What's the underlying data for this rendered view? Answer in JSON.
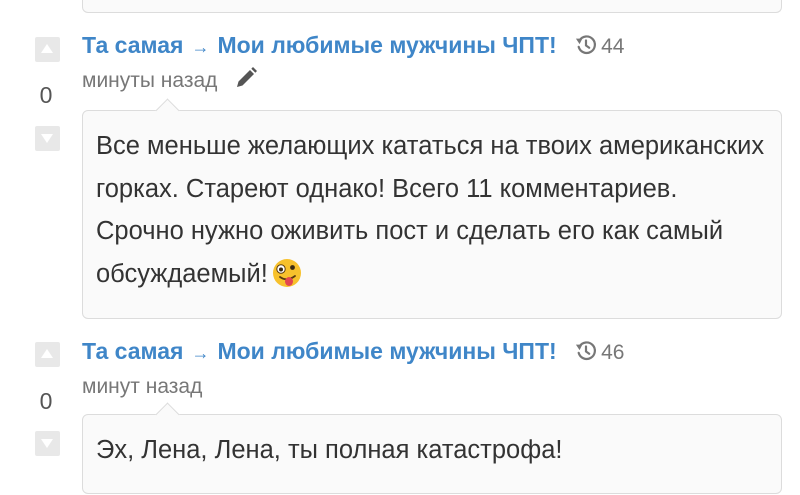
{
  "comments": [
    {
      "author": "Та самая",
      "arrow": "→",
      "target": "Мои любимые мужчины ЧПТ!",
      "time_first": "44",
      "time_rest": "минуты назад",
      "score": "0",
      "text": "Все меньше желающих кататься на твоих американских горках. Стареют однако! Всего 11 комментариев. Срочно нужно оживить пост и сделать его как самый обсуждаемый!",
      "emoji": "zany-face",
      "editable": true
    },
    {
      "author": "Та самая",
      "arrow": "→",
      "target": "Мои любимые мужчины ЧПТ!",
      "time_first": "46",
      "time_rest": "минут назад",
      "score": "0",
      "text": "Эх, Лена, Лена, ты полная катастрофа!",
      "editable": false
    }
  ],
  "colors": {
    "link": "#3f86c8",
    "muted": "#777777",
    "vote_bg": "#e8e8e8",
    "bubble_bg": "#fafafa",
    "border": "#dcdcdc"
  },
  "icons": [
    "vote-up-icon",
    "vote-down-icon",
    "history-clock-icon",
    "pencil-icon",
    "zany-face-emoji"
  ]
}
